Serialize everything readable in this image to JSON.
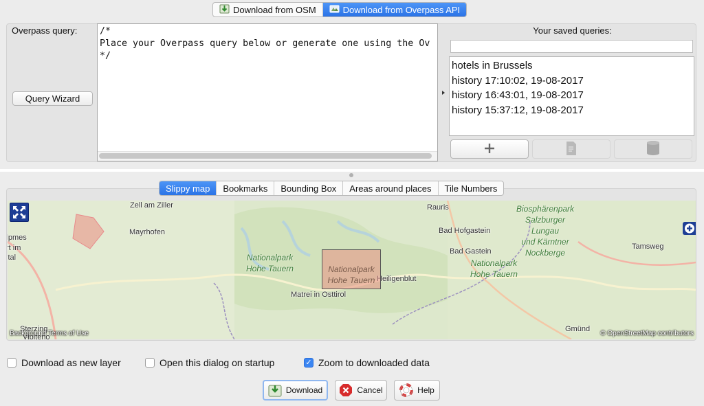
{
  "top_tabs": [
    {
      "label": "Download from OSM",
      "icon": "download-osm-icon",
      "active": false
    },
    {
      "label": "Download from Overpass API",
      "icon": "overpass-icon",
      "active": true
    }
  ],
  "query": {
    "label": "Overpass query:",
    "wizard_button": "Query Wizard",
    "text": "/*\nPlace your Overpass query below or generate one using the Ov\n*/"
  },
  "saved_queries": {
    "label": "Your saved queries:",
    "filter_value": "",
    "items": [
      "hotels in Brussels",
      "history 17:10:02, 19-08-2017",
      "history 16:43:01, 19-08-2017",
      "history 15:37:12, 19-08-2017"
    ],
    "actions": [
      "plus-icon",
      "edit-icon",
      "delete-icon"
    ]
  },
  "map_tabs": [
    {
      "label": "Slippy map",
      "active": true
    },
    {
      "label": "Bookmarks",
      "active": false
    },
    {
      "label": "Bounding Box",
      "active": false
    },
    {
      "label": "Areas around places",
      "active": false
    },
    {
      "label": "Tile Numbers",
      "active": false
    }
  ],
  "map": {
    "places": {
      "zell": "Zell am Ziller",
      "mayrhofen": "Mayrhofen",
      "rauris": "Rauris",
      "hofgastein": "Bad Hofgastein",
      "badgastein": "Bad Gastein",
      "heiligenblut": "Heiligenblut",
      "matrei": "Matrei in Osttirol",
      "tamsweg": "Tamsweg",
      "gmund": "Gmünd",
      "sterzing": "Sterzing",
      "vipiteno": "Vipiteno",
      "edge_ilpmes": "ilpmes",
      "edge_rt_im": "rt im",
      "edge_ital": "ital"
    },
    "parks": {
      "np_west": "Nationalpark\nHohe Tauern",
      "np_east": "Nationalpark\nHohe Tauern",
      "biosphere": "Biosphärenpark\nSalzburger\nLungau\nund Kärntner\nNockberge"
    },
    "selection_label": "Nationalpark\nHohe Tauern",
    "attribution_left": "Background Terms of Use",
    "attribution_right": "© OpenStreetMap contributors"
  },
  "options": [
    {
      "label": "Download as new layer",
      "checked": false
    },
    {
      "label": "Open this dialog on startup",
      "checked": false
    },
    {
      "label": "Zoom to downloaded data",
      "checked": true
    }
  ],
  "buttons": {
    "download": "Download",
    "cancel": "Cancel",
    "help": "Help"
  },
  "colors": {
    "accent": "#2b73e6",
    "map_bg": "#d9e7c8",
    "selection": "#e89084"
  }
}
